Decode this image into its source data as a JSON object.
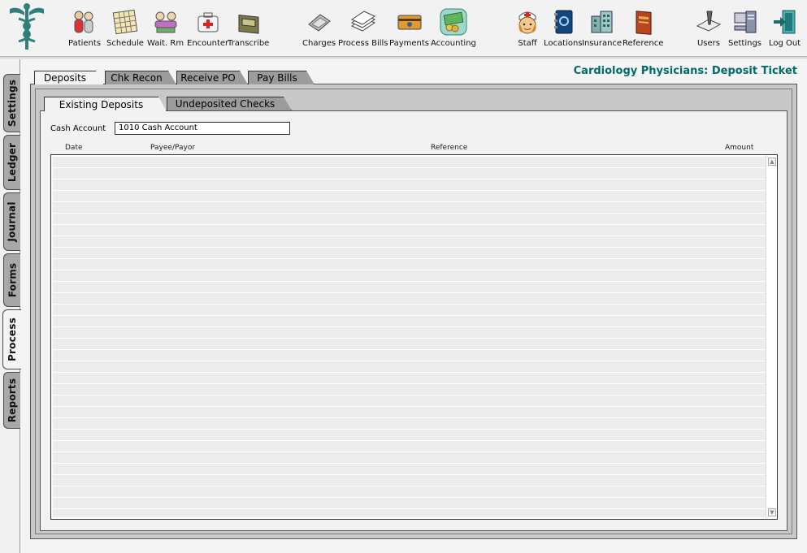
{
  "toolbar": {
    "items": [
      {
        "label": "Patients",
        "icon": "patients-icon"
      },
      {
        "label": "Schedule",
        "icon": "calendar-icon"
      },
      {
        "label": "Wait. Rm",
        "icon": "waiting-room-icon"
      },
      {
        "label": "Encounter",
        "icon": "medical-kit-icon"
      },
      {
        "label": "Transcribe",
        "icon": "tape-recorder-icon"
      },
      {
        "label": "Charges",
        "icon": "calculator-icon"
      },
      {
        "label": "Process Bills",
        "icon": "paper-stack-icon"
      },
      {
        "label": "Payments",
        "icon": "credit-card-icon"
      },
      {
        "label": "Accounting",
        "icon": "money-icon"
      },
      {
        "label": "Staff",
        "icon": "nurse-icon"
      },
      {
        "label": "Locations",
        "icon": "address-book-icon"
      },
      {
        "label": "Insurance",
        "icon": "building-icon"
      },
      {
        "label": "Reference",
        "icon": "book-icon"
      },
      {
        "label": "Users",
        "icon": "user-pen-icon"
      },
      {
        "label": "Settings",
        "icon": "settings-computer-icon"
      },
      {
        "label": "Log Out",
        "icon": "log-out-icon"
      }
    ]
  },
  "sidebar": {
    "tabs": [
      {
        "label": "Settings"
      },
      {
        "label": "Ledger"
      },
      {
        "label": "Journal"
      },
      {
        "label": "Forms"
      },
      {
        "label": "Process",
        "active": true
      },
      {
        "label": "Reports"
      }
    ]
  },
  "page_title": "Cardiology Physicians:  Deposit Ticket",
  "main_tabs": [
    {
      "label": "Deposits",
      "active": true
    },
    {
      "label": "Chk Recon"
    },
    {
      "label": "Receive PO"
    },
    {
      "label": "Pay Bills"
    }
  ],
  "sub_tabs": [
    {
      "label": "Existing Deposits",
      "active": true
    },
    {
      "label": "Undeposited Checks"
    }
  ],
  "cash_account": {
    "label": "Cash Account",
    "value": "1010 Cash Account"
  },
  "table": {
    "columns": [
      "Date",
      "Payee/Payor",
      "Reference",
      "Amount"
    ],
    "rows": []
  },
  "colors": {
    "title": "#006b6b",
    "tab_inactive": "#9c9c9c",
    "panel": "#c8c8c8"
  }
}
